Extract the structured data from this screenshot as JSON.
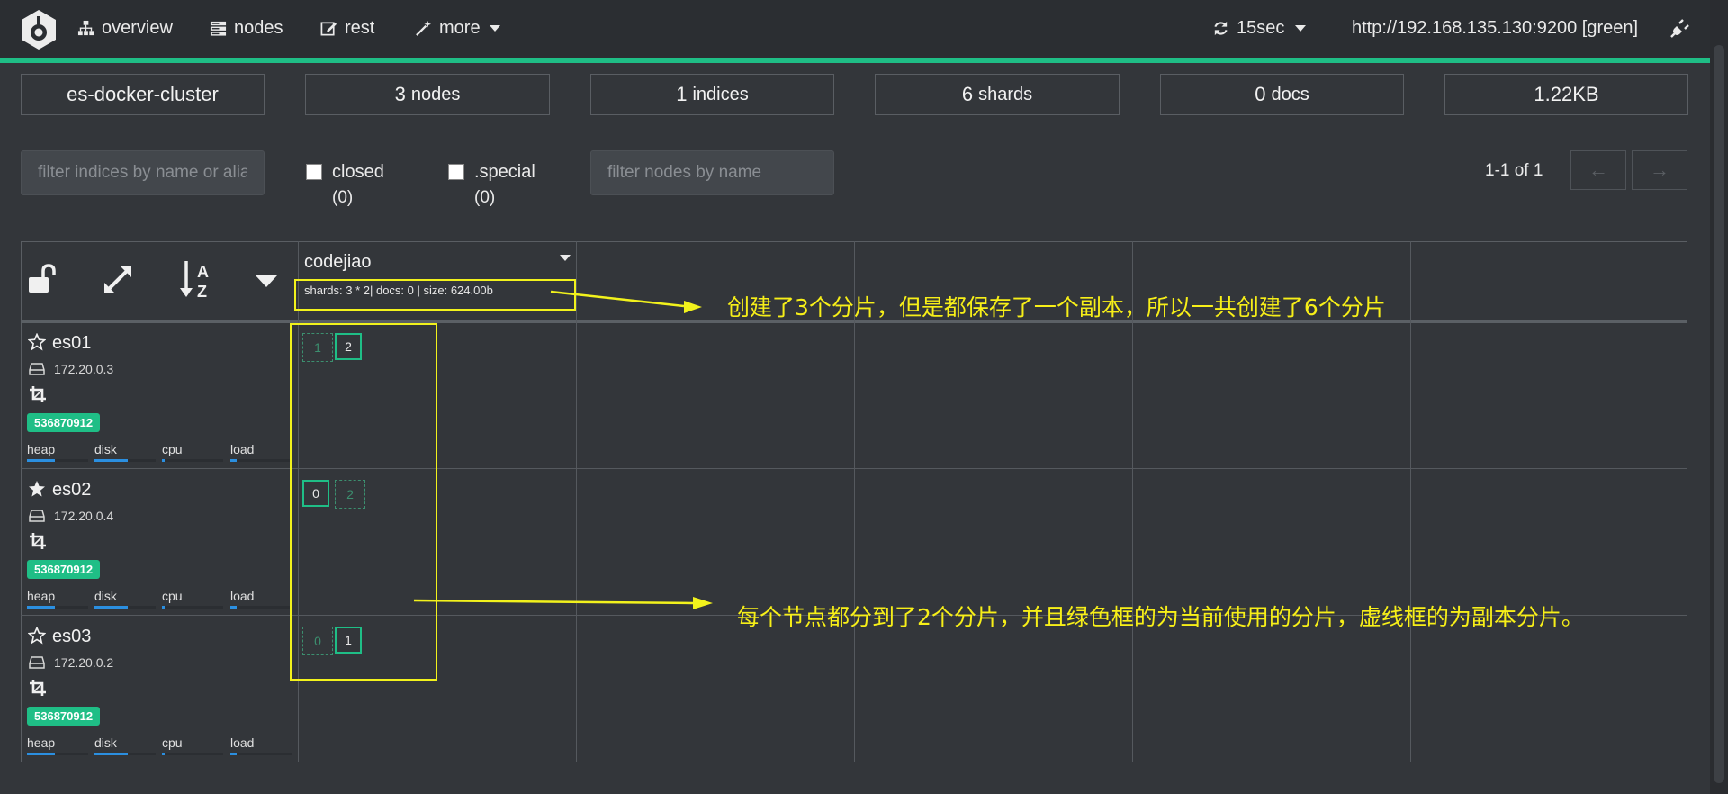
{
  "navbar": {
    "items": [
      {
        "icon": "sitemap-icon",
        "label": "overview"
      },
      {
        "icon": "server-icon",
        "label": "nodes"
      },
      {
        "icon": "edit-icon",
        "label": "rest"
      },
      {
        "icon": "magic-wand-icon",
        "label": "more"
      }
    ],
    "refresh_label": "15sec",
    "connection": "http://192.168.135.130:9200 [green]",
    "accent_color": "#1fbe86"
  },
  "stats": {
    "cluster_name": "es-docker-cluster",
    "nodes_num": "3",
    "nodes_label": "nodes",
    "indices_num": "1",
    "indices_label": "indices",
    "shards_num": "6",
    "shards_label": "shards",
    "docs_num": "0",
    "docs_label": "docs",
    "size": "1.22KB"
  },
  "filters": {
    "indices_placeholder": "filter indices by name or aliases",
    "closed_label": "closed",
    "closed_count": "(0)",
    "special_label": ".special",
    "special_count": "(0)",
    "nodes_placeholder": "filter nodes by name",
    "pagination": "1-1 of 1",
    "prev": "←",
    "next": "→"
  },
  "index": {
    "name": "codejiao",
    "meta": "shards: 3 * 2| docs: 0 | size: 624.00b"
  },
  "nodes": [
    {
      "name": "es01",
      "master": false,
      "ip": "172.20.0.3",
      "badge": "536870912"
    },
    {
      "name": "es02",
      "master": true,
      "ip": "172.20.0.4",
      "badge": "536870912"
    },
    {
      "name": "es03",
      "master": false,
      "ip": "172.20.0.2",
      "badge": "536870912"
    }
  ],
  "metrics": {
    "heap": "heap",
    "disk": "disk",
    "cpu": "cpu",
    "load": "load"
  },
  "shards": {
    "es01": [
      {
        "id": "1",
        "primary": false
      },
      {
        "id": "2",
        "primary": true
      }
    ],
    "es02": [
      {
        "id": "0",
        "primary": true
      },
      {
        "id": "2",
        "primary": false
      }
    ],
    "es03": [
      {
        "id": "0",
        "primary": false
      },
      {
        "id": "1",
        "primary": true
      }
    ]
  },
  "annotations": {
    "note1": "创建了3个分片，但是都保存了一个副本，所以一共创建了6个分片",
    "note2": "每个节点都分到了2个分片，并且绿色框的为当前使用的分片，虚线框的为副本分片。",
    "color": "#f2f21c"
  }
}
